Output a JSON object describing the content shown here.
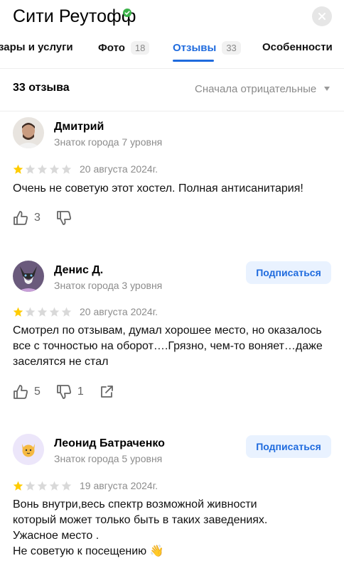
{
  "header": {
    "title": "Сити Реутофф"
  },
  "tabs": [
    {
      "label": "зары и услуги",
      "count": ""
    },
    {
      "label": "Фото",
      "count": "18"
    },
    {
      "label": "Отзывы",
      "count": "33"
    },
    {
      "label": "Особенности",
      "count": ""
    }
  ],
  "reviews_count": "33 отзыва",
  "sort_label": "Сначала отрицательные",
  "reviews": [
    {
      "author": "Дмитрий",
      "level": "Знаток города 7 уровня",
      "rating": 1,
      "date": "20 августа 2024г.",
      "text": "Очень не советую этот хостел. Полная антисанитария!",
      "likes": "3",
      "dislikes": "",
      "subscribe": ""
    },
    {
      "author": "Денис Д.",
      "level": "Знаток города 3 уровня",
      "rating": 1,
      "date": "20 августа 2024г.",
      "text": "Смотрел по отзывам, думал хорошее место, но оказалось все с точностью на оборот….Грязно, чем-то воняет…даже заселятся не стал",
      "likes": "5",
      "dislikes": "1",
      "subscribe": "Подписаться"
    },
    {
      "author": "Леонид Батраченко",
      "level": "Знаток города 5 уровня",
      "rating": 1,
      "date": "19 августа 2024г.",
      "text_lines": [
        "Вонь внутри,весь спектр возможной живности",
        "который может только быть в таких заведениях.",
        "Ужасное место .",
        "Не советую к посещению"
      ],
      "text_emoji": "👋",
      "subscribe": "Подписаться"
    }
  ],
  "colors": {
    "accent": "#1f6bde",
    "star_filled": "#ffcc00",
    "star_empty": "#d9d9d9"
  }
}
